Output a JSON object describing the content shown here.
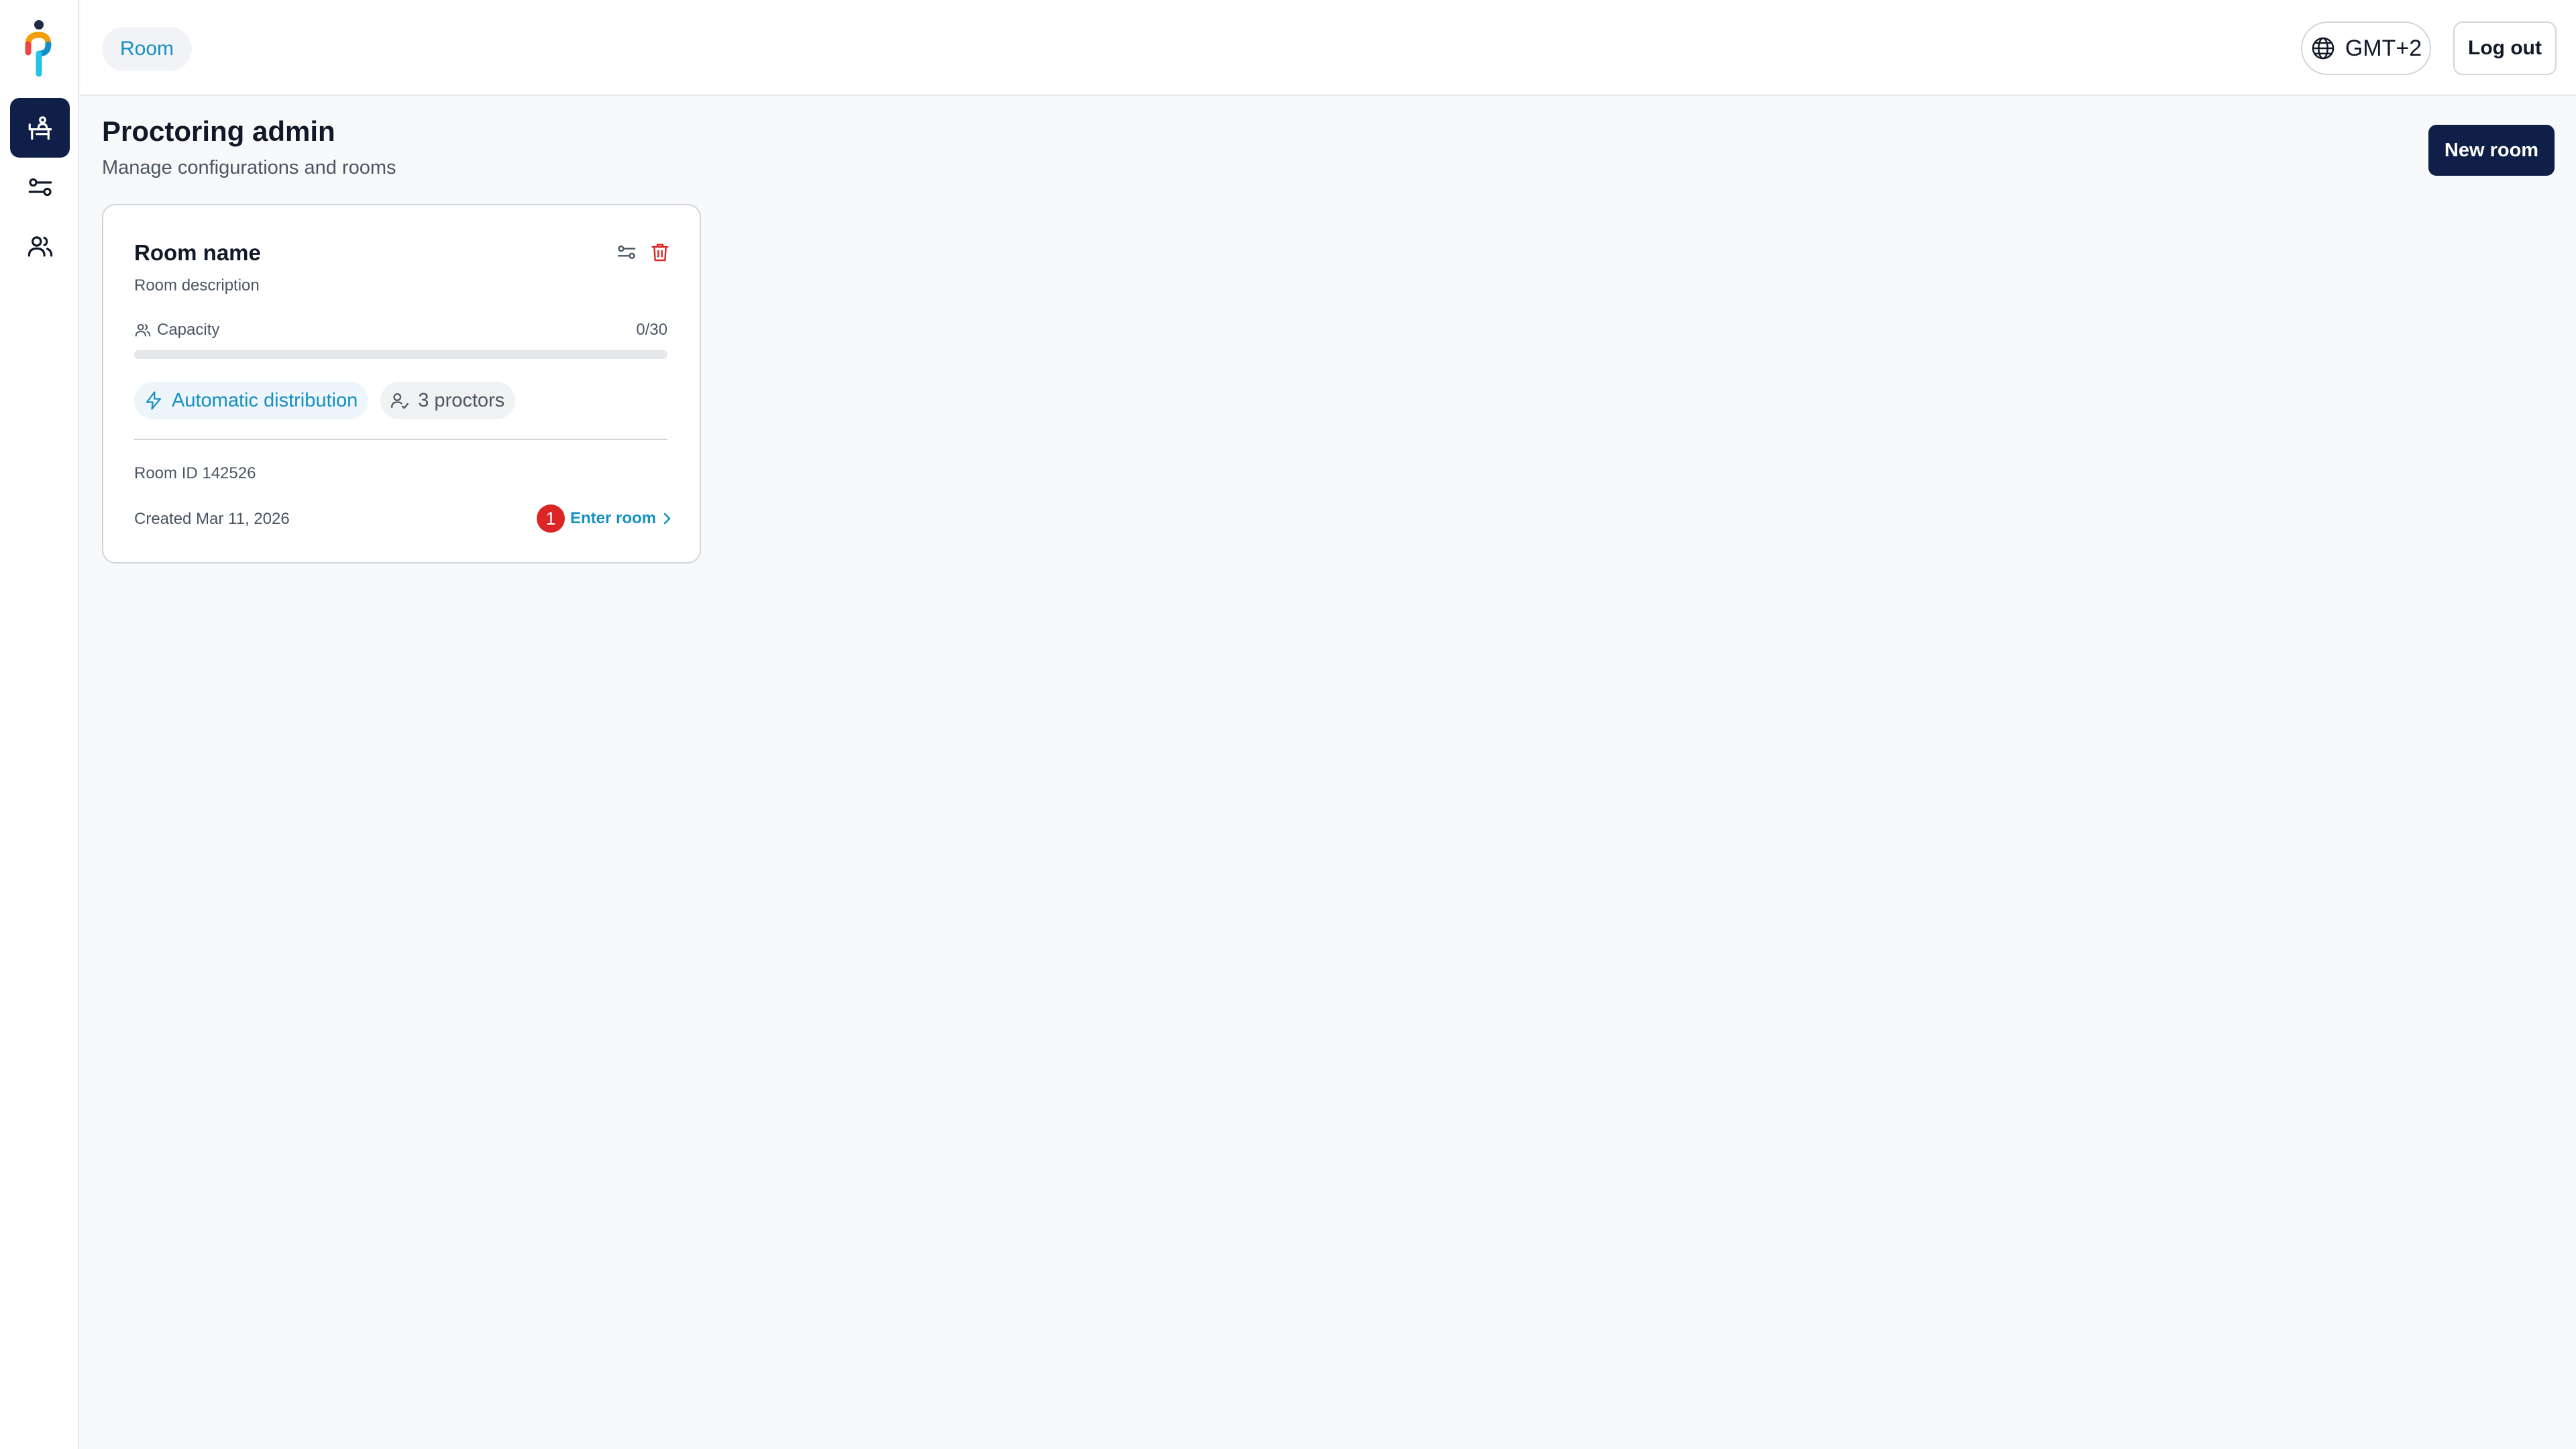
{
  "topbar": {
    "breadcrumb": "Room",
    "timezone": "GMT+2",
    "logout_label": "Log out"
  },
  "sidebar": {
    "items": [
      {
        "icon": "desk-room-icon",
        "active": true
      },
      {
        "icon": "sliders-icon",
        "active": false
      },
      {
        "icon": "users-icon",
        "active": false
      }
    ]
  },
  "header": {
    "title": "Proctoring admin",
    "subtitle": "Manage configurations and rooms",
    "new_room_label": "New room"
  },
  "room_card": {
    "name": "Room name",
    "description": "Room description",
    "capacity_label": "Capacity",
    "capacity_value": "0/30",
    "capacity_fraction": 0,
    "distribution_label": "Automatic distribution",
    "proctors_label": "3 proctors",
    "room_id": "Room ID 142526",
    "created": "Created Mar 11, 2026",
    "notification_count": "1",
    "enter_label": "Enter room"
  },
  "colors": {
    "brand_navy": "#0f1f47",
    "accent_blue": "#1590c4",
    "danger_red": "#dc2626"
  }
}
